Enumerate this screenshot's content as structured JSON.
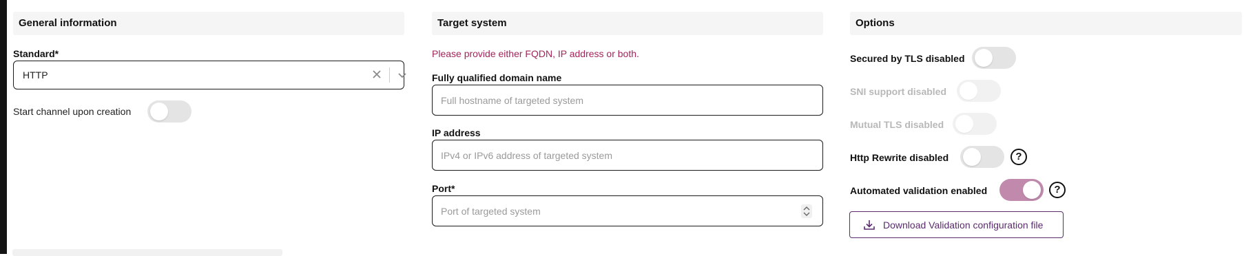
{
  "general": {
    "header": "General information",
    "standard_label": "Standard*",
    "standard_value": "HTTP",
    "start_channel_label": "Start channel upon creation"
  },
  "target": {
    "header": "Target system",
    "hint": "Please provide either FQDN, IP address or both.",
    "fqdn_label": "Fully qualified domain name",
    "fqdn_placeholder": "Full hostname of targeted system",
    "ip_label": "IP address",
    "ip_placeholder": "IPv4 or IPv6 address of targeted system",
    "port_label": "Port*",
    "port_placeholder": "Port of targeted system"
  },
  "options": {
    "header": "Options",
    "tls_label": "Secured by TLS disabled",
    "sni_label": "SNI support disabled",
    "mtls_label": "Mutual TLS disabled",
    "rewrite_label": "Http Rewrite disabled",
    "validation_label": "Automated validation enabled",
    "help_glyph": "?",
    "download_label": "Download Validation configuration file"
  },
  "colors": {
    "accent": "#c18aad",
    "error_text": "#a3245a",
    "button_text": "#5a2a6d"
  },
  "icons": [
    "clear-icon",
    "chevron-down-icon",
    "help-icon",
    "download-icon",
    "spinner-arrows-icon"
  ]
}
